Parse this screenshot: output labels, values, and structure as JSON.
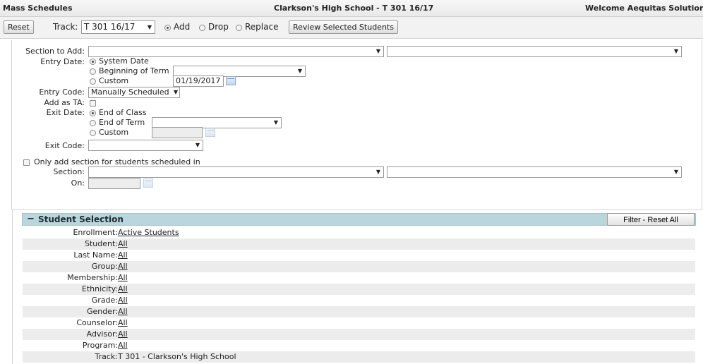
{
  "titlebar": {
    "left": "Mass Schedules",
    "center": "Clarkson's High School - T 301 16/17",
    "right": "Welcome Aequitas Solution"
  },
  "toolbar": {
    "reset_label": "Reset",
    "track_label": "Track:",
    "track_value": "T 301 16/17",
    "mode_options": [
      "Add",
      "Drop",
      "Replace"
    ],
    "mode_selected": "Add",
    "review_label": "Review Selected Students"
  },
  "form": {
    "section_to_add_label": "Section to Add:",
    "entry_date_label": "Entry Date:",
    "entry_date_options": [
      "System Date",
      "Beginning of Term",
      "Custom"
    ],
    "entry_date_selected": "System Date",
    "entry_custom_value": "01/19/2017",
    "entry_code_label": "Entry Code:",
    "entry_code_value": "Manually Scheduled",
    "add_as_ta_label": "Add as TA:",
    "exit_date_label": "Exit Date:",
    "exit_date_options": [
      "End of Class",
      "End of Term",
      "Custom"
    ],
    "exit_date_selected": "End of Class",
    "exit_code_label": "Exit Code:",
    "only_add_label": "Only add section for students scheduled in",
    "section_label": "Section:",
    "on_label": "On:"
  },
  "student_selection": {
    "toggle": "−",
    "title": "Student Selection",
    "filter_reset_label": "Filter - Reset All",
    "rows": [
      {
        "label": "Enrollment:",
        "value": "Active Students",
        "link": true
      },
      {
        "label": "Student:",
        "value": "All",
        "link": true
      },
      {
        "label": "Last Name:",
        "value": "All",
        "link": true
      },
      {
        "label": "Group:",
        "value": "All",
        "link": true
      },
      {
        "label": "Membership:",
        "value": "All",
        "link": true
      },
      {
        "label": "Ethnicity:",
        "value": "All",
        "link": true
      },
      {
        "label": "Grade:",
        "value": "All",
        "link": true
      },
      {
        "label": "Gender:",
        "value": "All",
        "link": true
      },
      {
        "label": "Counselor:",
        "value": "All",
        "link": true
      },
      {
        "label": "Advisor:",
        "value": "All",
        "link": true
      },
      {
        "label": "Program:",
        "value": "All",
        "link": true
      },
      {
        "label": "Track:",
        "value": "T 301 - Clarkson's High School",
        "link": false
      }
    ]
  }
}
